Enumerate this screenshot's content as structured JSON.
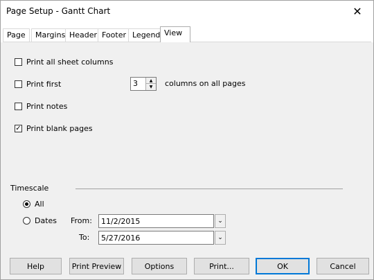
{
  "window": {
    "title": "Page Setup - Gantt Chart",
    "close_glyph": "✕"
  },
  "tabs": [
    {
      "label": "Page",
      "active": false
    },
    {
      "label": "Margins",
      "active": false
    },
    {
      "label": "Header",
      "active": false
    },
    {
      "label": "Footer",
      "active": false
    },
    {
      "label": "Legend",
      "active": false
    },
    {
      "label": "View",
      "active": true
    }
  ],
  "view": {
    "print_all_sheet_columns": {
      "label": "Print all sheet columns",
      "checked": false
    },
    "print_first": {
      "label": "Print first",
      "checked": false,
      "value": "3",
      "suffix": "columns on all pages"
    },
    "print_notes": {
      "label": "Print notes",
      "checked": false
    },
    "print_blank_pages": {
      "label": "Print blank pages",
      "checked": true
    }
  },
  "timescale": {
    "label": "Timescale",
    "all": {
      "label": "All",
      "selected": true
    },
    "dates": {
      "label": "Dates",
      "selected": false
    },
    "from_label": "From:",
    "from_value": "11/2/2015",
    "to_label": "To:",
    "to_value": "5/27/2016"
  },
  "buttons": {
    "help": "Help",
    "print_preview": "Print Preview",
    "options": "Options",
    "print": "Print...",
    "ok": "OK",
    "cancel": "Cancel"
  },
  "glyphs": {
    "check": "✓",
    "spin_up": "▲",
    "spin_down": "▼",
    "combo_arrow": "⌄"
  }
}
